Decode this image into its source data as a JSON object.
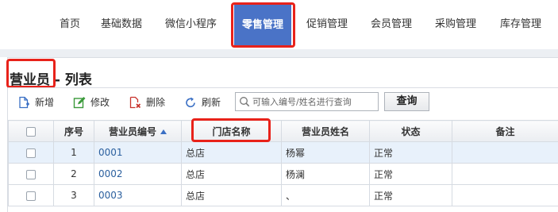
{
  "nav": {
    "items": [
      {
        "label": "首页",
        "active": false
      },
      {
        "label": "基础数据",
        "active": false
      },
      {
        "label": "微信小程序",
        "active": false
      },
      {
        "label": "零售管理",
        "active": true
      },
      {
        "label": "促销管理",
        "active": false
      },
      {
        "label": "会员管理",
        "active": false
      },
      {
        "label": "采购管理",
        "active": false
      },
      {
        "label": "库存管理",
        "active": false
      }
    ]
  },
  "page": {
    "title": "营业员 - 列表"
  },
  "toolbar": {
    "add_label": "新增",
    "edit_label": "修改",
    "delete_label": "删除",
    "refresh_label": "刷新",
    "search_placeholder": "可输入编号/姓名进行查询",
    "query_label": "查询"
  },
  "table": {
    "columns": [
      "序号",
      "营业员编号",
      "门店名称",
      "营业员姓名",
      "状态",
      "备注"
    ],
    "rows": [
      {
        "index": "1",
        "code": "0001",
        "store": "总店",
        "name": "杨幂",
        "status": "正常",
        "note": ""
      },
      {
        "index": "2",
        "code": "0002",
        "store": "总店",
        "name": "杨澜",
        "status": "正常",
        "note": ""
      },
      {
        "index": "3",
        "code": "0003",
        "store": "总店",
        "name": "、",
        "status": "正常",
        "note": ""
      }
    ]
  },
  "colors": {
    "nav_active_bg": "#4a73c7",
    "highlight_outline": "#e8221a",
    "link_code": "#2a5f9e"
  },
  "icons": {
    "add": "add-document-icon",
    "edit": "edit-pencil-icon",
    "delete": "delete-document-icon",
    "refresh": "refresh-icon",
    "search": "search-icon",
    "sort": "sort-ascending-icon"
  }
}
